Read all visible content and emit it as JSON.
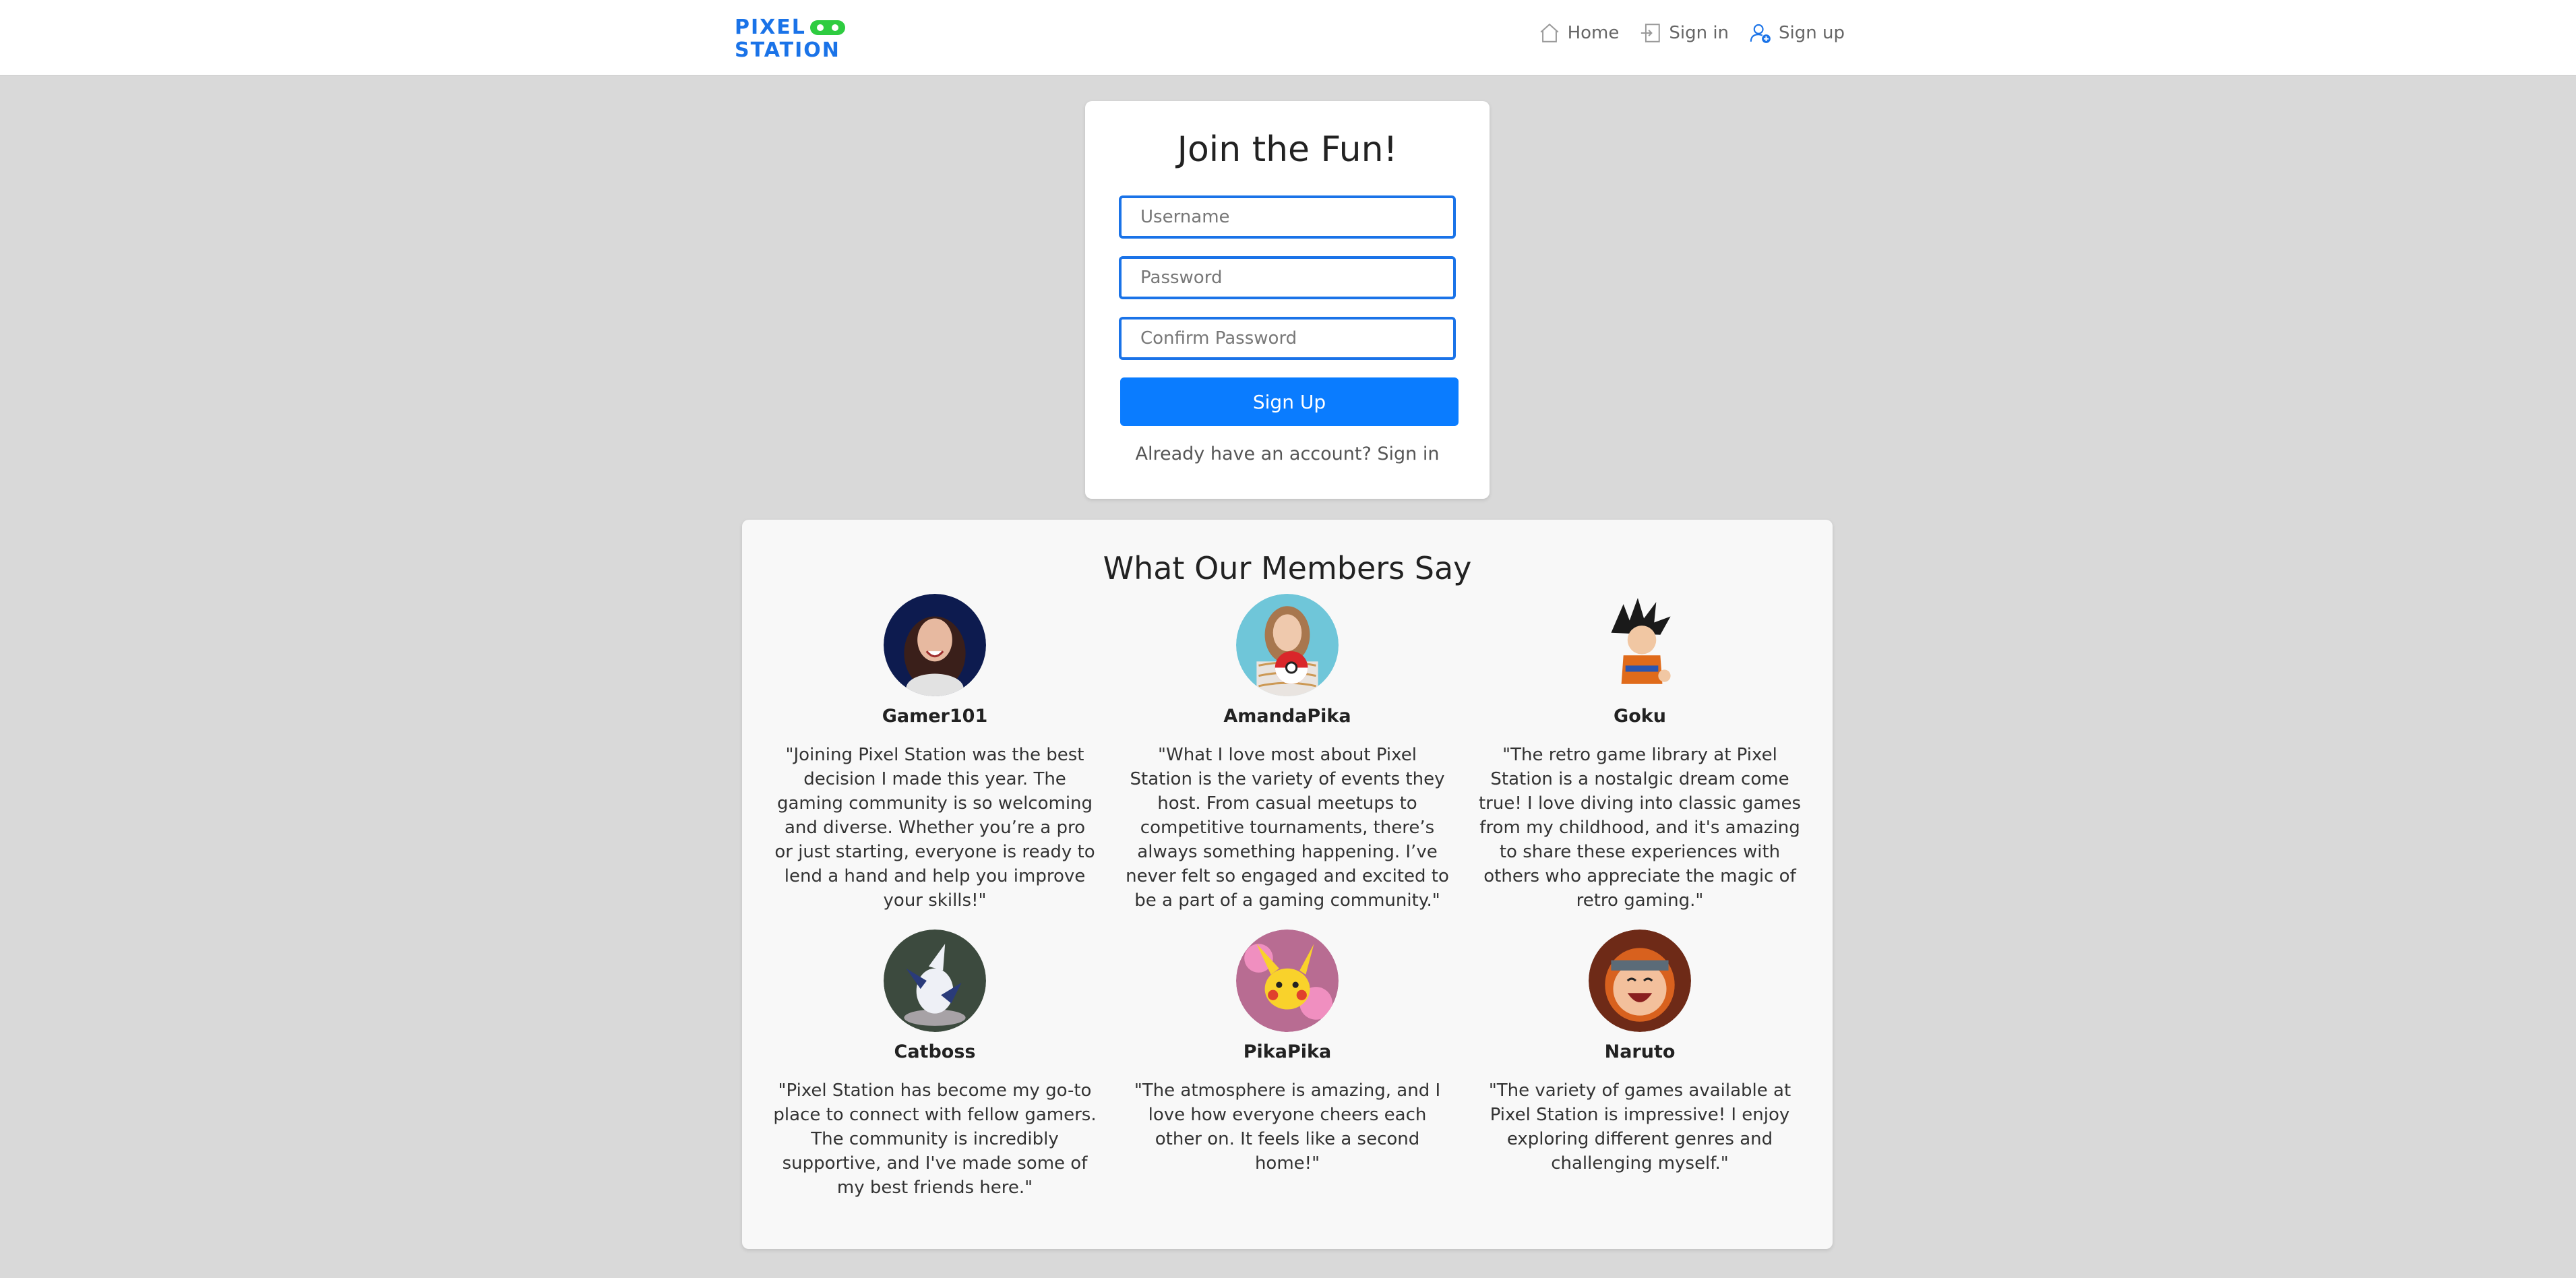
{
  "brand": {
    "line1": "PIXEL",
    "line2": "STATION",
    "accent": "#1a73e8",
    "pad_color": "#2ecc40"
  },
  "nav": [
    {
      "label": "Home",
      "icon": "home-icon"
    },
    {
      "label": "Sign in",
      "icon": "sign-in-icon"
    },
    {
      "label": "Sign up",
      "icon": "add-user-icon"
    }
  ],
  "signup": {
    "title": "Join the Fun!",
    "username_placeholder": "Username",
    "password_placeholder": "Password",
    "confirm_placeholder": "Confirm Password",
    "button": "Sign Up",
    "already_text": "Already have an account?",
    "signin_link": "Sign in"
  },
  "testimonials": {
    "title": "What Our Members Say",
    "members": [
      {
        "name": "Gamer101",
        "quote": "\"Joining Pixel Station was the best decision I made this year. The gaming community is so welcoming and diverse. Whether you’re a pro or just starting, everyone is ready to lend a hand and help you improve your skills!\""
      },
      {
        "name": "AmandaPika",
        "quote": "\"What I love most about Pixel Station is the variety of events they host. From casual meetups to competitive tournaments, there’s always something happening. I’ve never felt so engaged and excited to be a part of a gaming community.\""
      },
      {
        "name": "Goku",
        "quote": "\"The retro game library at Pixel Station is a nostalgic dream come true! I love diving into classic games from my childhood, and it's amazing to share these experiences with others who appreciate the magic of retro gaming.\""
      },
      {
        "name": "Catboss",
        "quote": "\"Pixel Station has become my go-to place to connect with fellow gamers. The community is incredibly supportive, and I've made some of my best friends here.\""
      },
      {
        "name": "PikaPika",
        "quote": "\"The atmosphere is amazing, and I love how everyone cheers each other on. It feels like a second home!\""
      },
      {
        "name": "Naruto",
        "quote": "\"The variety of games available at Pixel Station is impressive! I enjoy exploring different genres and challenging myself.\""
      }
    ]
  }
}
